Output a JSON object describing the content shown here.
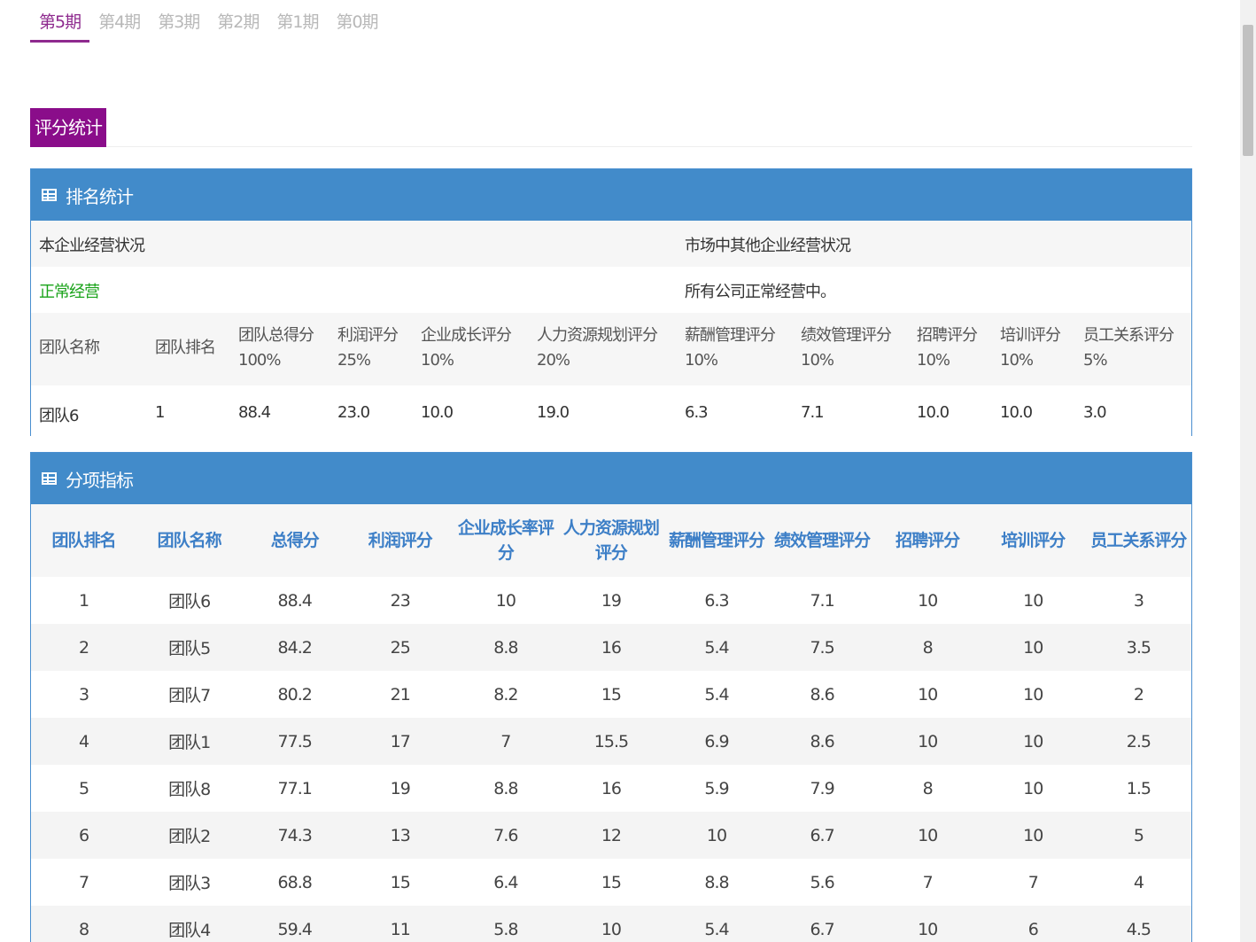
{
  "tabs": [
    {
      "label": "第5期",
      "active": true
    },
    {
      "label": "第4期",
      "active": false
    },
    {
      "label": "第3期",
      "active": false
    },
    {
      "label": "第2期",
      "active": false
    },
    {
      "label": "第1期",
      "active": false
    },
    {
      "label": "第0期",
      "active": false
    }
  ],
  "section_title": "评分统计",
  "ranking_panel": {
    "title": "排名统计",
    "own_status_label": "本企业经营状况",
    "market_status_label": "市场中其他企业经营状况",
    "own_status_value": "正常经营",
    "market_status_value": "所有公司正常经营中。",
    "headers": [
      {
        "name": "团队名称",
        "weight": ""
      },
      {
        "name": "团队排名",
        "weight": ""
      },
      {
        "name": "团队总得分",
        "weight": "100%"
      },
      {
        "name": "利润评分",
        "weight": "25%"
      },
      {
        "name": "企业成长评分",
        "weight": "10%"
      },
      {
        "name": "人力资源规划评分",
        "weight": "20%"
      },
      {
        "name": "薪酬管理评分",
        "weight": "10%"
      },
      {
        "name": "绩效管理评分",
        "weight": "10%"
      },
      {
        "name": "招聘评分",
        "weight": "10%"
      },
      {
        "name": "培训评分",
        "weight": "10%"
      },
      {
        "name": "员工关系评分",
        "weight": "5%"
      }
    ],
    "row": [
      "团队6",
      "1",
      "88.4",
      "23.0",
      "10.0",
      "19.0",
      "6.3",
      "7.1",
      "10.0",
      "10.0",
      "3.0"
    ]
  },
  "index_panel": {
    "title": "分项指标",
    "headers": [
      "团队排名",
      "团队名称",
      "总得分",
      "利润评分",
      "企业成长率评分",
      "人力资源规划评分",
      "薪酬管理评分",
      "绩效管理评分",
      "招聘评分",
      "培训评分",
      "员工关系评分"
    ],
    "rows": [
      [
        "1",
        "团队6",
        "88.4",
        "23",
        "10",
        "19",
        "6.3",
        "7.1",
        "10",
        "10",
        "3"
      ],
      [
        "2",
        "团队5",
        "84.2",
        "25",
        "8.8",
        "16",
        "5.4",
        "7.5",
        "8",
        "10",
        "3.5"
      ],
      [
        "3",
        "团队7",
        "80.2",
        "21",
        "8.2",
        "15",
        "5.4",
        "8.6",
        "10",
        "10",
        "2"
      ],
      [
        "4",
        "团队1",
        "77.5",
        "17",
        "7",
        "15.5",
        "6.9",
        "8.6",
        "10",
        "10",
        "2.5"
      ],
      [
        "5",
        "团队8",
        "77.1",
        "19",
        "8.8",
        "16",
        "5.9",
        "7.9",
        "8",
        "10",
        "1.5"
      ],
      [
        "6",
        "团队2",
        "74.3",
        "13",
        "7.6",
        "12",
        "10",
        "6.7",
        "10",
        "10",
        "5"
      ],
      [
        "7",
        "团队3",
        "68.8",
        "15",
        "6.4",
        "15",
        "8.8",
        "5.6",
        "7",
        "7",
        "4"
      ],
      [
        "8",
        "团队4",
        "59.4",
        "11",
        "5.8",
        "10",
        "5.4",
        "6.7",
        "10",
        "6",
        "4.5"
      ]
    ]
  },
  "colors": {
    "accent_purple": "#8a0d8a",
    "panel_blue": "#428bca",
    "header_text_blue": "#3d7fc7",
    "status_green": "#1aa31a"
  }
}
